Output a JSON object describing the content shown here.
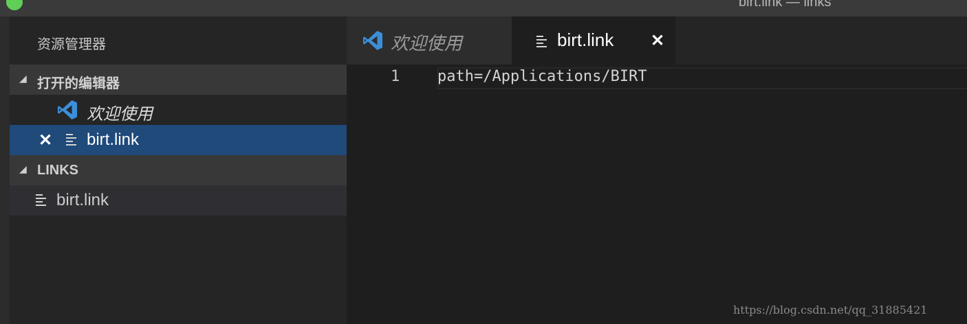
{
  "window": {
    "title": "birt.link — links"
  },
  "sidebar": {
    "title": "资源管理器",
    "open_editors": {
      "header": "打开的编辑器",
      "items": [
        {
          "label": "欢迎使用",
          "icon": "vscode-icon",
          "italic": true
        },
        {
          "label": "birt.link",
          "icon": "file-lines-icon",
          "selected": true,
          "close_glyph": "✕"
        }
      ]
    },
    "folder": {
      "header": "LINKS",
      "items": [
        {
          "label": "birt.link",
          "icon": "file-lines-icon"
        }
      ]
    }
  },
  "tabs": [
    {
      "label": "欢迎使用",
      "icon": "vscode-icon",
      "active": false
    },
    {
      "label": "birt.link",
      "icon": "file-lines-icon",
      "active": true,
      "close_glyph": "✕"
    }
  ],
  "editor": {
    "lines": [
      {
        "number": "1",
        "text": "path=/Applications/BIRT"
      }
    ]
  },
  "watermark": "https://blog.csdn.net/qq_31885421",
  "colors": {
    "selection": "#1f4a7a",
    "traffic_green": "#5fcf58",
    "vscode_blue": "#3b8fd8"
  }
}
